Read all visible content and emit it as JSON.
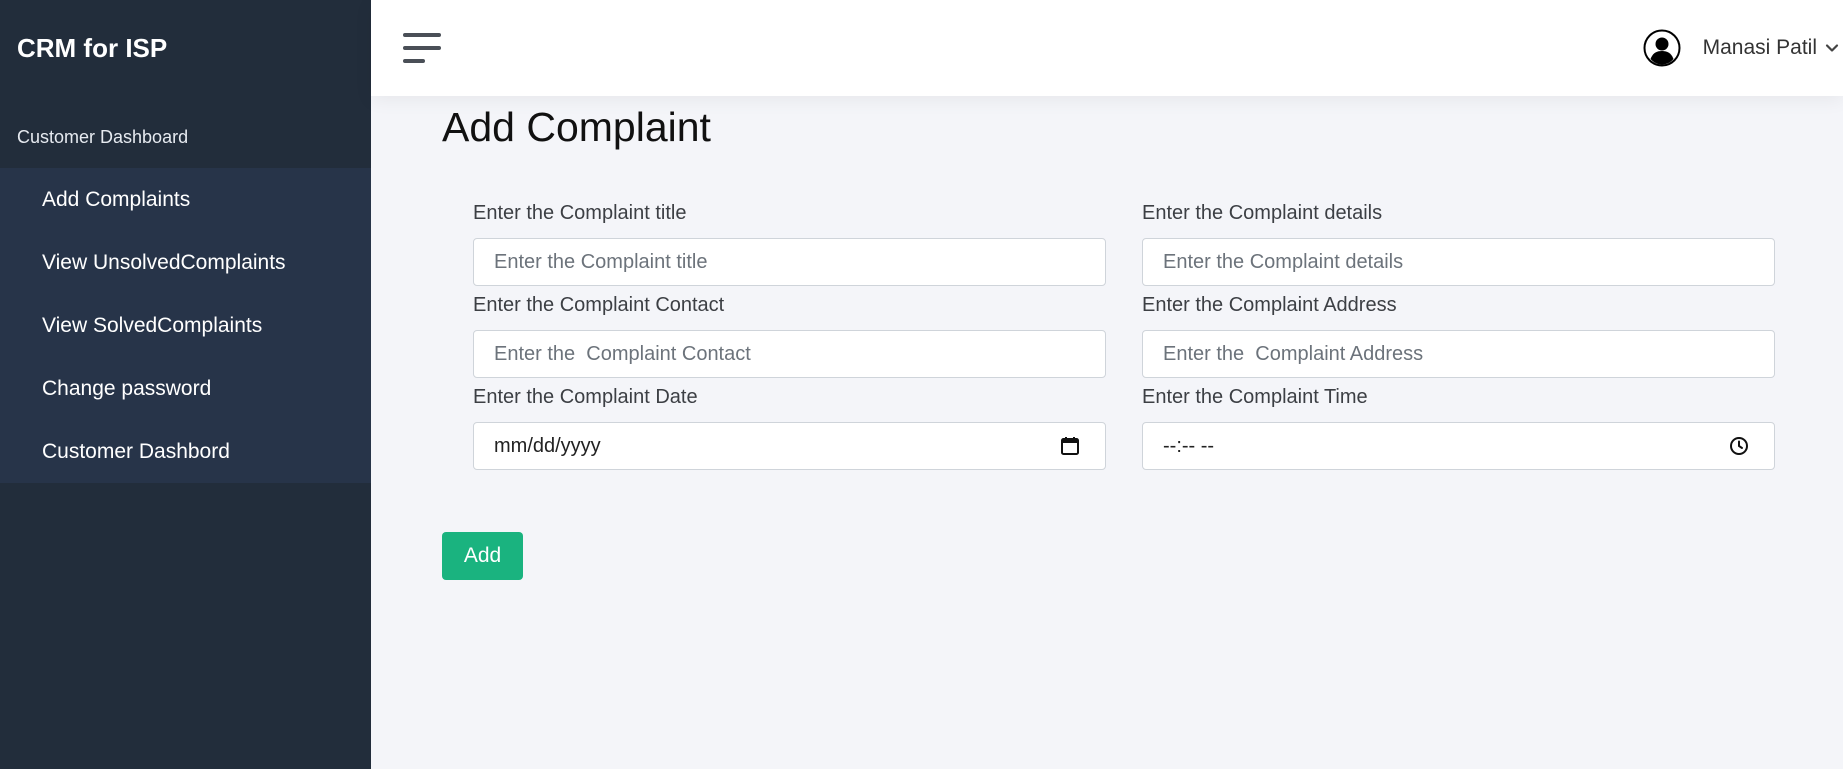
{
  "sidebar": {
    "brand": "CRM for ISP",
    "section_label": "Customer Dashboard",
    "items": [
      {
        "label": "Add Complaints"
      },
      {
        "label": "View UnsolvedComplaints"
      },
      {
        "label": "View SolvedComplaints"
      },
      {
        "label": "Change password"
      },
      {
        "label": "Customer Dashbord"
      }
    ]
  },
  "topbar": {
    "user_name": "Manasi Patil",
    "icons": [
      "menu-icon",
      "user-avatar-icon",
      "chevron-down-icon"
    ]
  },
  "page": {
    "title": "Add Complaint"
  },
  "form": {
    "title": {
      "label": "Enter the Complaint title",
      "placeholder": "Enter the Complaint title"
    },
    "details": {
      "label": "Enter the Complaint details",
      "placeholder": "Enter the Complaint details"
    },
    "contact": {
      "label": "Enter the Complaint Contact",
      "placeholder": "Enter the  Complaint Contact"
    },
    "address": {
      "label": "Enter the Complaint Address",
      "placeholder": "Enter the  Complaint Address"
    },
    "date": {
      "label": "Enter the Complaint Date",
      "value": "mm/dd/yyyy",
      "icon": "calendar-icon"
    },
    "time": {
      "label": "Enter the Complaint Time",
      "value": "--:-- --",
      "icon": "clock-icon"
    },
    "submit_label": "Add"
  },
  "colors": {
    "sidebar_bg": "#222d3b",
    "menu_bg": "#273449",
    "page_bg": "#f4f5f9",
    "accent": "#1ab37f"
  }
}
